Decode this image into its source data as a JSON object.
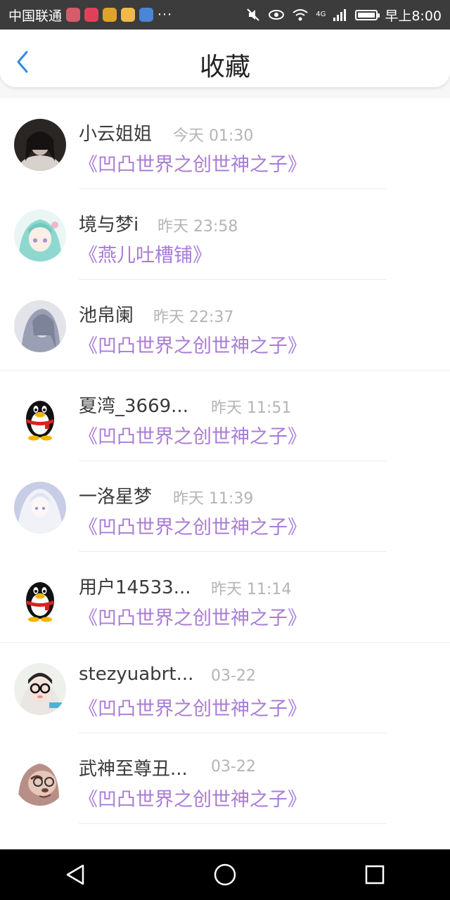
{
  "status_bar": {
    "carrier": "中国联通",
    "more": "···",
    "network": "4G",
    "time": "早上8:00",
    "colors": {
      "icon1": "#d65c6b",
      "icon2": "#e0415a",
      "icon3": "#e0a32a",
      "icon4": "#f0b94a",
      "icon5": "#4a86d6"
    }
  },
  "header": {
    "title": "收藏",
    "back_icon": "chevron-left-icon",
    "back_color": "#2f8be0"
  },
  "colors": {
    "book_title": "#a97cd6",
    "time": "#b4b4b4",
    "name": "#3a3a3a"
  },
  "items": [
    {
      "name": "小云姐姐",
      "time": "今天 01:30",
      "book": "《凹凸世界之创世神之子》",
      "avatar": "photo-avatar-dark"
    },
    {
      "name": "境与梦i",
      "time": "昨天 23:58",
      "book": "《燕儿吐槽铺》",
      "avatar": "anime-avatar-teal"
    },
    {
      "name": "池帛阑",
      "time": "昨天 22:37",
      "book": "《凹凸世界之创世神之子》",
      "avatar": "anime-avatar-gray"
    },
    {
      "name": "夏湾_3669...",
      "time": "昨天 11:51",
      "book": "《凹凸世界之创世神之子》",
      "avatar": "qq-penguin-avatar"
    },
    {
      "name": "一洛星梦",
      "time": "昨天 11:39",
      "book": "《凹凸世界之创世神之子》",
      "avatar": "anime-avatar-white"
    },
    {
      "name": "用户14533...",
      "time": "昨天 11:14",
      "book": "《凹凸世界之创世神之子》",
      "avatar": "qq-penguin-avatar"
    },
    {
      "name": "stezyuabrt...",
      "time": "03-22",
      "book": "《凹凸世界之创世神之子》",
      "avatar": "photo-avatar-glasses"
    },
    {
      "name": "武神至尊丑...",
      "time": "03-22",
      "book": "《凹凸世界之创世神之子》",
      "avatar": "sloth-avatar"
    }
  ],
  "nav_bar": {
    "back_icon": "triangle-back-icon",
    "home_icon": "circle-home-icon",
    "recents_icon": "square-recents-icon"
  }
}
